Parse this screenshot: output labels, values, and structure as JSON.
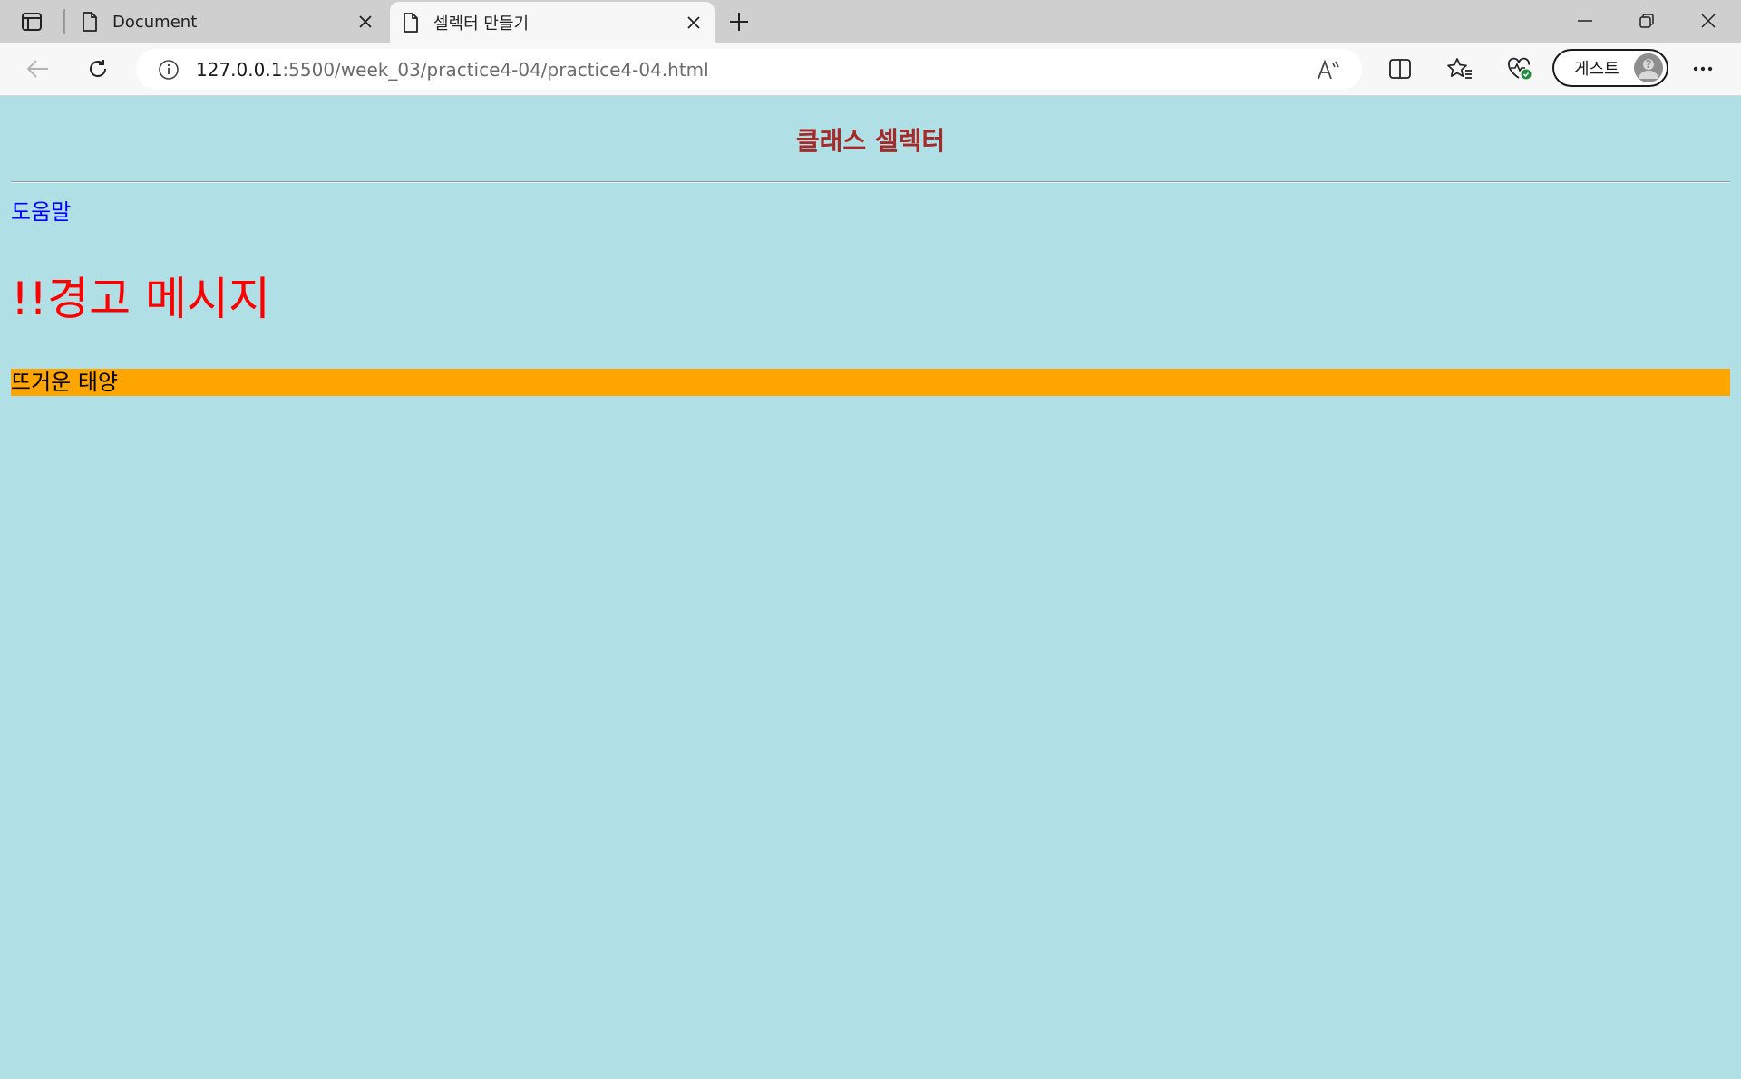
{
  "tabs": [
    {
      "title": "Document",
      "active": false
    },
    {
      "title": "셀렉터 만들기",
      "active": true
    }
  ],
  "toolbar": {
    "url_host": "127.0.0.1",
    "url_rest": ":5500/week_03/practice4-04/practice4-04.html",
    "profile_label": "게스트"
  },
  "page": {
    "heading": "클래스 셀렉터",
    "help": "도움말",
    "warning": "!!경고 메시지",
    "sun": "뜨거운 태양"
  },
  "colors": {
    "page_background": "#b0dfe5",
    "heading": "#a52a2a",
    "help": "#0000ff",
    "warning": "#ff0000",
    "sun_background": "#ffa500"
  },
  "icons": [
    "tab-actions-icon",
    "page-icon",
    "close-icon",
    "plus-icon",
    "minimize-icon",
    "restore-icon",
    "back-arrow-icon",
    "reload-icon",
    "info-icon",
    "read-aloud-icon",
    "split-screen-icon",
    "favorites-icon",
    "browser-essentials-icon",
    "avatar-icon",
    "more-icon"
  ]
}
